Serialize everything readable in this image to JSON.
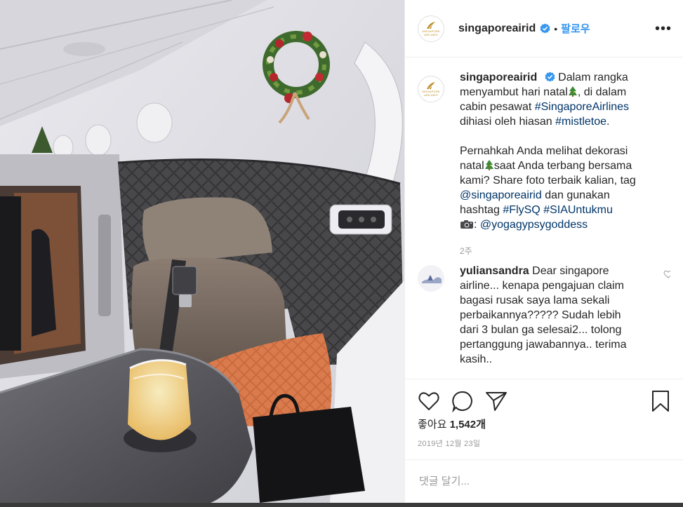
{
  "post": {
    "username": "singaporeairid",
    "brand_text": "SINGAPORE AIRLINES",
    "follow_label": "팔로우",
    "separator": "•",
    "more_label": "•••",
    "caption": {
      "line1_before_tree": "Dalam rangka menyambut hari natal",
      "line1_after_tree": ", di dalam cabin pesawat ",
      "hashtag1": "#SingaporeAirlines",
      "line1_tail": " dihiasi oleh hiasan ",
      "hashtag2": "#mistletoe",
      "line1_end": ".",
      "p2_before_tree": "Pernahkah Anda melihat dekorasi natal",
      "p2_after_tree": "saat Anda terbang bersama kami? Share foto terbaik kalian, tag ",
      "mention1": "@singaporeairid",
      "p2_mid": " dan gunakan hashtag ",
      "hashtag3": "#FlySQ",
      "hashtag4": "#SIAUntukmu",
      "p2_colon": ": ",
      "mention2": "@yogagypsygoddess"
    },
    "age": "2주",
    "comments": [
      {
        "username": "yuliansandra",
        "text": "Dear singapore airline... kenapa pengajuan claim bagasi rusak saya lama sekali perbaikannya????? Sudah lebih dari 3 bulan ga selesai2... tolong pertanggung jawabannya.. terima kasih.."
      }
    ],
    "likes_label": "좋아요",
    "likes_count": "1,542개",
    "date": "2019년 12월 23일",
    "comment_placeholder": "댓글 달기..."
  },
  "colors": {
    "link": "#003569",
    "follow": "#3897f0",
    "verified": "#3897f0",
    "muted": "#999999",
    "brand_gold": "#c0902e"
  },
  "icons": {
    "like": "heart-icon",
    "comment": "comment-bubble-icon",
    "share": "paper-plane-icon",
    "save": "bookmark-icon",
    "verified": "verified-badge-icon"
  }
}
